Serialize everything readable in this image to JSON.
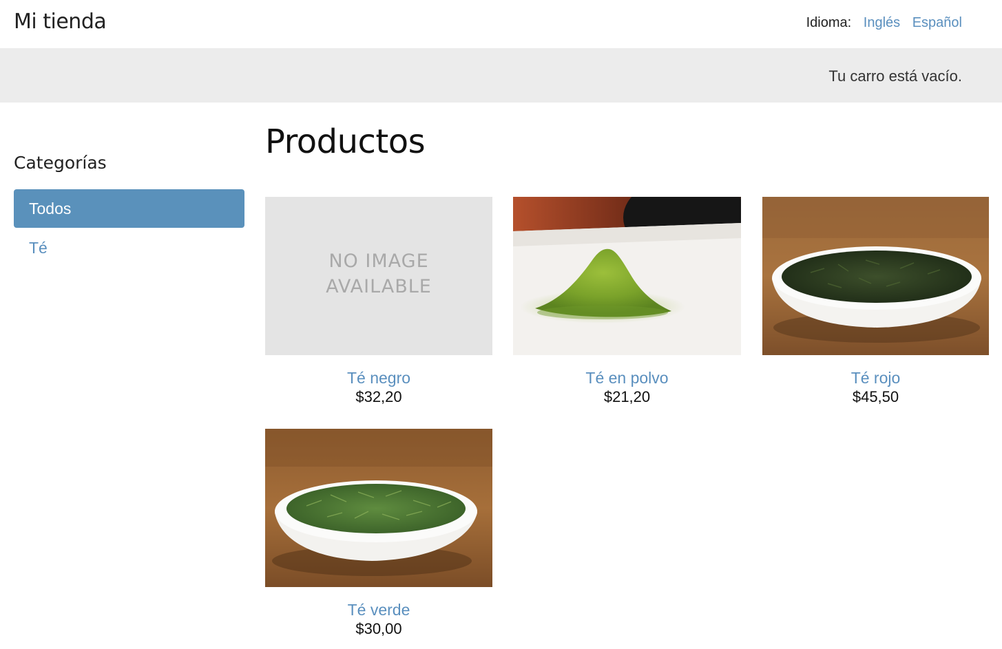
{
  "header": {
    "logo": "Mi tienda",
    "language_label": "Idioma:",
    "languages": [
      "Inglés",
      "Español"
    ]
  },
  "cart": {
    "status": "Tu carro está vacío."
  },
  "sidebar": {
    "title": "Categorías",
    "items": [
      {
        "label": "Todos",
        "active": true
      },
      {
        "label": "Té",
        "active": false
      }
    ]
  },
  "main": {
    "title": "Productos",
    "products": [
      {
        "name": "Té negro",
        "price": "$32,20",
        "image": "no-image-placeholder",
        "placeholder_text": [
          "NO IMAGE",
          "AVAILABLE"
        ]
      },
      {
        "name": "Té en polvo",
        "price": "$21,20",
        "image": "matcha-powder-photo"
      },
      {
        "name": "Té rojo",
        "price": "$45,50",
        "image": "tea-leaves-bowl-photo"
      },
      {
        "name": "Té verde",
        "price": "$30,00",
        "image": "green-tea-bowl-photo"
      }
    ]
  },
  "colors": {
    "link": "#5a8fbe",
    "active_category_bg": "#5a91bb",
    "cart_bar_bg": "#ececec"
  }
}
